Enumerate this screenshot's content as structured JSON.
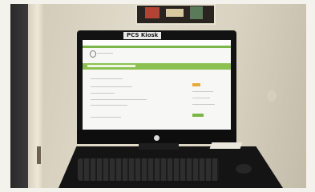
{
  "kiosk_sign": {
    "label": "PCS Kiosk"
  },
  "colors": {
    "screen_green": "#7ab648",
    "banner_green": "#8cc152",
    "accent_orange": "#e8a93a"
  }
}
